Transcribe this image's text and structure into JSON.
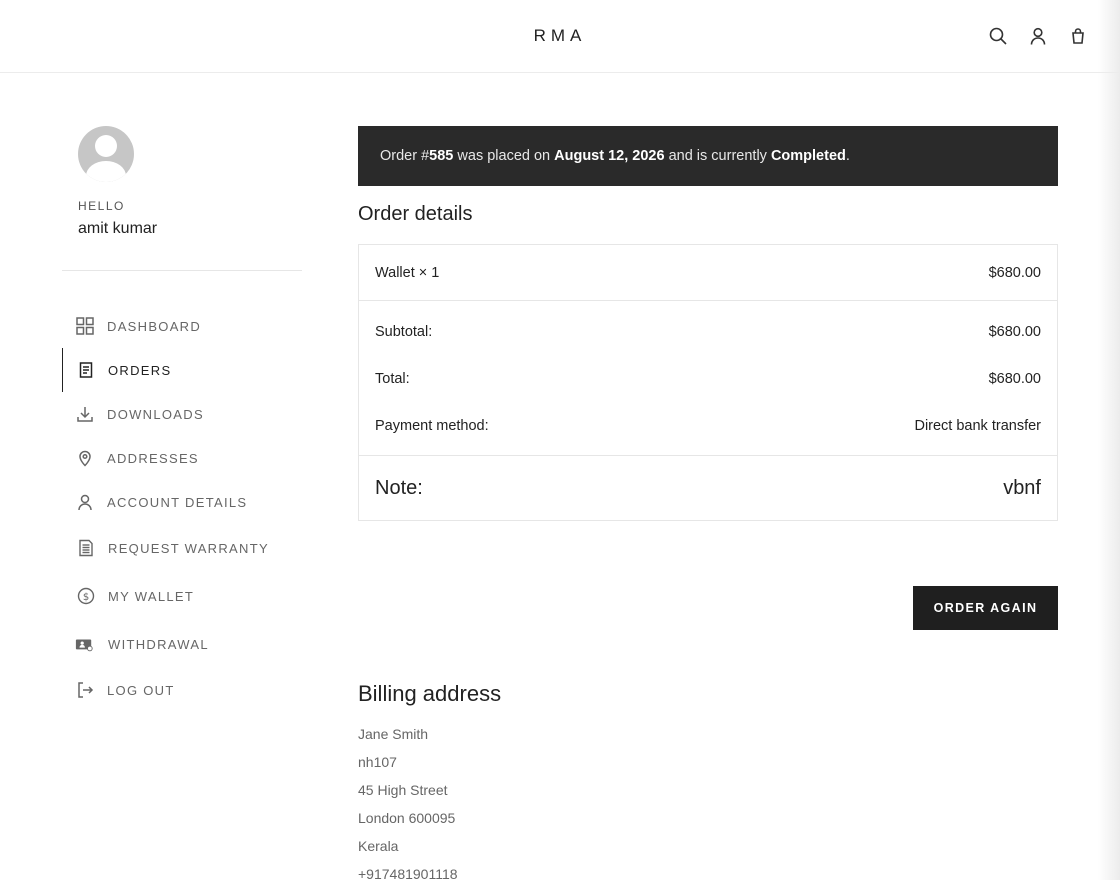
{
  "header": {
    "brand": "RMA",
    "icons": [
      "search-icon",
      "user-icon",
      "bag-icon"
    ]
  },
  "sidebar": {
    "greeting": "HELLO",
    "username": "amit kumar",
    "items": [
      {
        "label": "DASHBOARD",
        "icon": "dashboard-icon",
        "active": false
      },
      {
        "label": "ORDERS",
        "icon": "orders-icon",
        "active": true
      },
      {
        "label": "DOWNLOADS",
        "icon": "download-icon",
        "active": false
      },
      {
        "label": "ADDRESSES",
        "icon": "location-pin-icon",
        "active": false
      },
      {
        "label": "ACCOUNT DETAILS",
        "icon": "user-icon",
        "active": false
      },
      {
        "label": "REQUEST WARRANTY",
        "icon": "document-icon",
        "active": false
      },
      {
        "label": "MY WALLET",
        "icon": "dollar-coin-icon",
        "active": false
      },
      {
        "label": "WITHDRAWAL",
        "icon": "withdrawal-icon",
        "active": false
      },
      {
        "label": "LOG OUT",
        "icon": "logout-icon",
        "active": false
      }
    ]
  },
  "banner": {
    "t1": "Order #",
    "order_number": "585",
    "t2": " was placed on ",
    "date": "August 12, 2026",
    "t3": " and is currently ",
    "status": "Completed",
    "t4": "."
  },
  "order_details": {
    "title": "Order details",
    "item": {
      "name": "Wallet × 1",
      "price": "$680.00"
    },
    "subtotal_label": "Subtotal:",
    "subtotal_value": "$680.00",
    "total_label": "Total:",
    "total_value": "$680.00",
    "payment_label": "Payment method:",
    "payment_value": "Direct bank transfer",
    "note_label": "Note:",
    "note_value": "vbnf"
  },
  "order_again_label": "ORDER AGAIN",
  "billing": {
    "title": "Billing address",
    "lines": [
      "Jane Smith",
      "nh107",
      "45 High Street",
      "London 600095",
      "Kerala",
      "+917481901118"
    ]
  }
}
